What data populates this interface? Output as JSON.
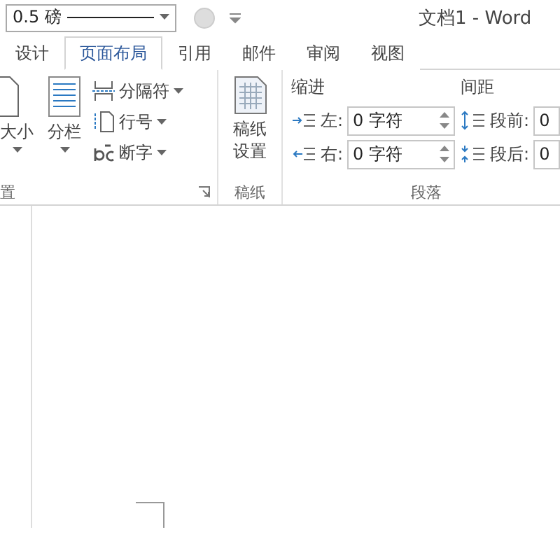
{
  "toolbar": {
    "pen_weight": "0.5 磅"
  },
  "window": {
    "title": "文档1 - Word"
  },
  "tabs": [
    {
      "label": "设计",
      "selected": false
    },
    {
      "label": "页面布局",
      "selected": true
    },
    {
      "label": "引用",
      "selected": false
    },
    {
      "label": "邮件",
      "selected": false
    },
    {
      "label": "审阅",
      "selected": false
    },
    {
      "label": "视图",
      "selected": false
    }
  ],
  "page_setup_group": {
    "label": "置",
    "size_button": "大小",
    "columns_button": "分栏",
    "menu_items": [
      {
        "label": "分隔符",
        "kind": "breaks"
      },
      {
        "label": "行号",
        "kind": "lines"
      },
      {
        "label": "断字",
        "kind": "hyphen"
      }
    ]
  },
  "manuscript_group": {
    "label": "稿纸",
    "button_lines": [
      "稿纸",
      "设置"
    ]
  },
  "paragraph_group": {
    "label": "段落",
    "indent": {
      "heading": "缩进",
      "fields": [
        {
          "label": "左:",
          "value": "0 字符",
          "kind": "left"
        },
        {
          "label": "右:",
          "value": "0 字符",
          "kind": "right"
        }
      ]
    },
    "spacing": {
      "heading": "间距",
      "fields": [
        {
          "label": "段前:",
          "value": "0",
          "kind": "before"
        },
        {
          "label": "段后:",
          "value": "0",
          "kind": "after"
        }
      ]
    }
  }
}
